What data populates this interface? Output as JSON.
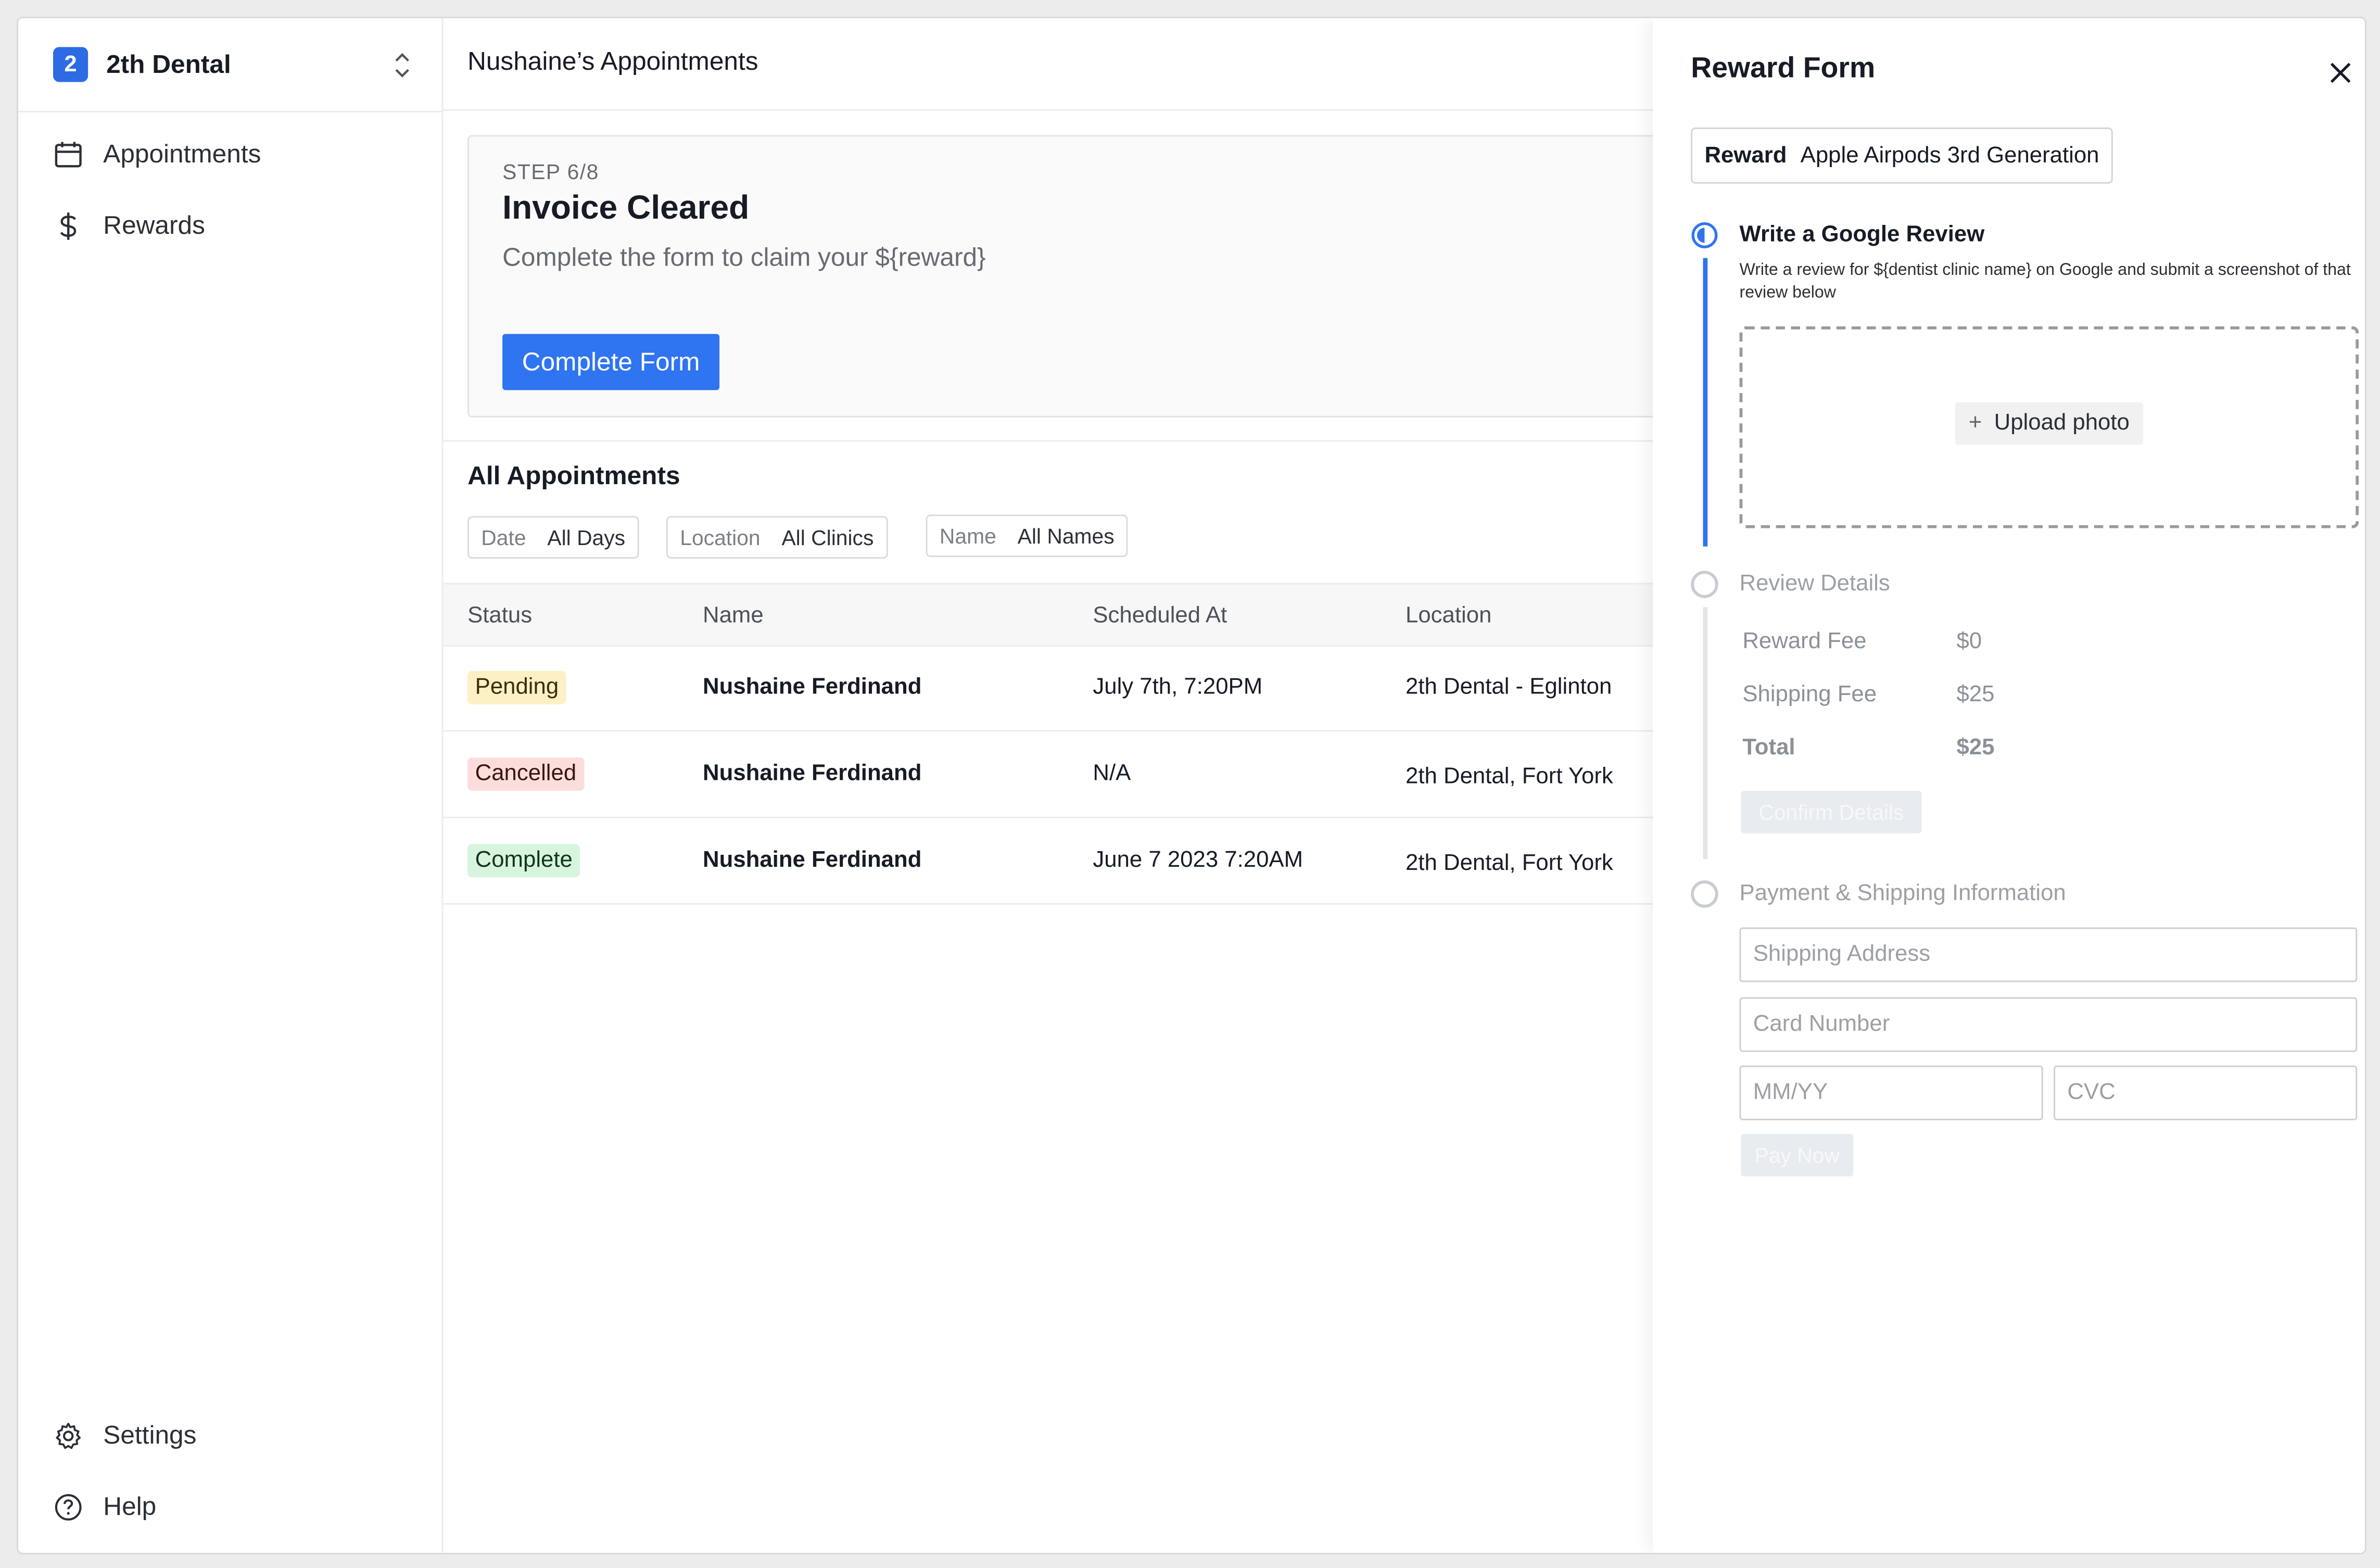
{
  "sidebar": {
    "brand_badge": "2",
    "brand_name": "2th Dental",
    "nav": {
      "appointments": "Appointments",
      "rewards": "Rewards",
      "settings": "Settings",
      "help": "Help"
    }
  },
  "main": {
    "title": "Nushaine’s Appointments",
    "step": {
      "label": "STEP 6/8",
      "title": "Invoice Cleared",
      "description": "Complete the form to claim your ${reward}",
      "button": "Complete Form"
    },
    "section_title": "All Appointments",
    "filters": [
      {
        "key": "Date",
        "value": "All Days"
      },
      {
        "key": "Location",
        "value": "All Clinics"
      },
      {
        "key": "Name",
        "value": "All Names"
      }
    ],
    "table": {
      "columns": [
        "Status",
        "Name",
        "Scheduled At",
        "Location"
      ],
      "rows": [
        {
          "status": "Pending",
          "name": "Nushaine Ferdinand",
          "scheduled": "July 7th, 7:20PM",
          "location": "2th Dental - Eglinton"
        },
        {
          "status": "Cancelled",
          "name": "Nushaine Ferdinand",
          "scheduled": "N/A",
          "location": "2th Dental, Fort York"
        },
        {
          "status": "Complete",
          "name": "Nushaine Ferdinand",
          "scheduled": "June 7 2023 7:20AM",
          "location": "2th Dental, Fort York"
        }
      ]
    }
  },
  "panel": {
    "title": "Reward Form",
    "reward_key": "Reward",
    "reward_value": "Apple Airpods 3rd Generation",
    "steps": {
      "review": {
        "title": "Write a Google Review",
        "hint": "Write a review for ${dentist clinic name} on Google and submit a screenshot of that review below",
        "upload": "Upload photo"
      },
      "details": {
        "title": "Review Details",
        "reward_fee_label": "Reward Fee",
        "reward_fee": "$0",
        "shipping_fee_label": "Shipping Fee",
        "shipping_fee": "$25",
        "total_label": "Total",
        "total": "$25",
        "confirm": "Confirm Details"
      },
      "payment": {
        "title": "Payment & Shipping Information",
        "address_placeholder": "Shipping Address",
        "card_placeholder": "Card Number",
        "expiry_placeholder": "MM/YY",
        "cvc_placeholder": "CVC",
        "pay": "Pay Now"
      }
    }
  },
  "colors": {
    "accent": "#2f74f0",
    "pending_bg": "#fdf0c4",
    "cancelled_bg": "#fbdedc",
    "complete_bg": "#d7f5de"
  }
}
